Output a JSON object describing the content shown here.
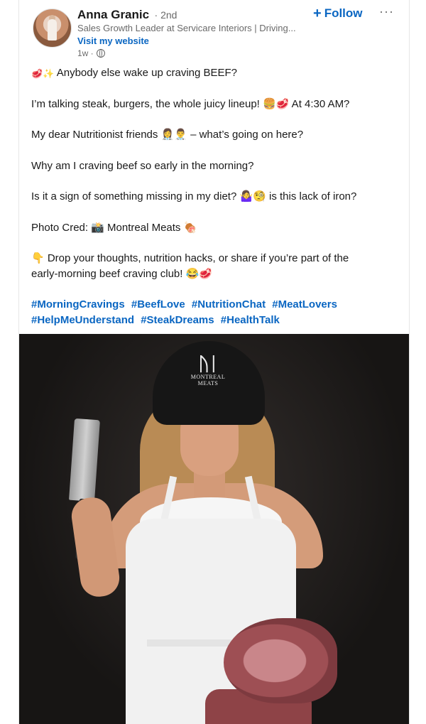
{
  "post": {
    "author": {
      "name": "Anna Granic",
      "degree": "· 2nd",
      "headline": "Sales Growth Leader at Servicare Interiors | Driving...",
      "website_label": "Visit my website",
      "time": "1w ·",
      "visibility_icon": "globe-icon"
    },
    "follow_label": "Follow",
    "more_icon": "···",
    "text": {
      "p1": "Anybody else wake up craving BEEF?",
      "p1_emoji": "🥩✨",
      "p2": "I’m talking steak, burgers, the whole juicy lineup! 🍔🥩 At 4:30 AM?",
      "p3": "My dear Nutritionist friends 👩‍⚕️👨‍⚕️ – what’s going on here?",
      "p4": "Why am I craving beef so early in the morning?",
      "p5": "Is it a sign of something missing in my diet? 🤷‍♀️🧐 is this lack of iron?",
      "p6": "Photo Cred: 📸 Montreal Meats 🍖",
      "p7a": "👇 Drop your thoughts, nutrition hacks, or share if you’re part of the",
      "p7b": "early-morning beef craving club! 😂🥩"
    },
    "hashtags": [
      "#MorningCravings",
      "#BeefLove",
      "#NutritionChat",
      "#MeatLovers",
      "#HelpMeUnderstand",
      "#SteakDreams",
      "#HealthTalk"
    ],
    "photo": {
      "beanie_logo_mark": "ᚢᛁ",
      "beanie_logo_text_1": "MONTREAL",
      "beanie_logo_text_2": "MEATS"
    }
  },
  "colors": {
    "link": "#0a66c2",
    "text": "#191919",
    "muted": "#666666"
  }
}
